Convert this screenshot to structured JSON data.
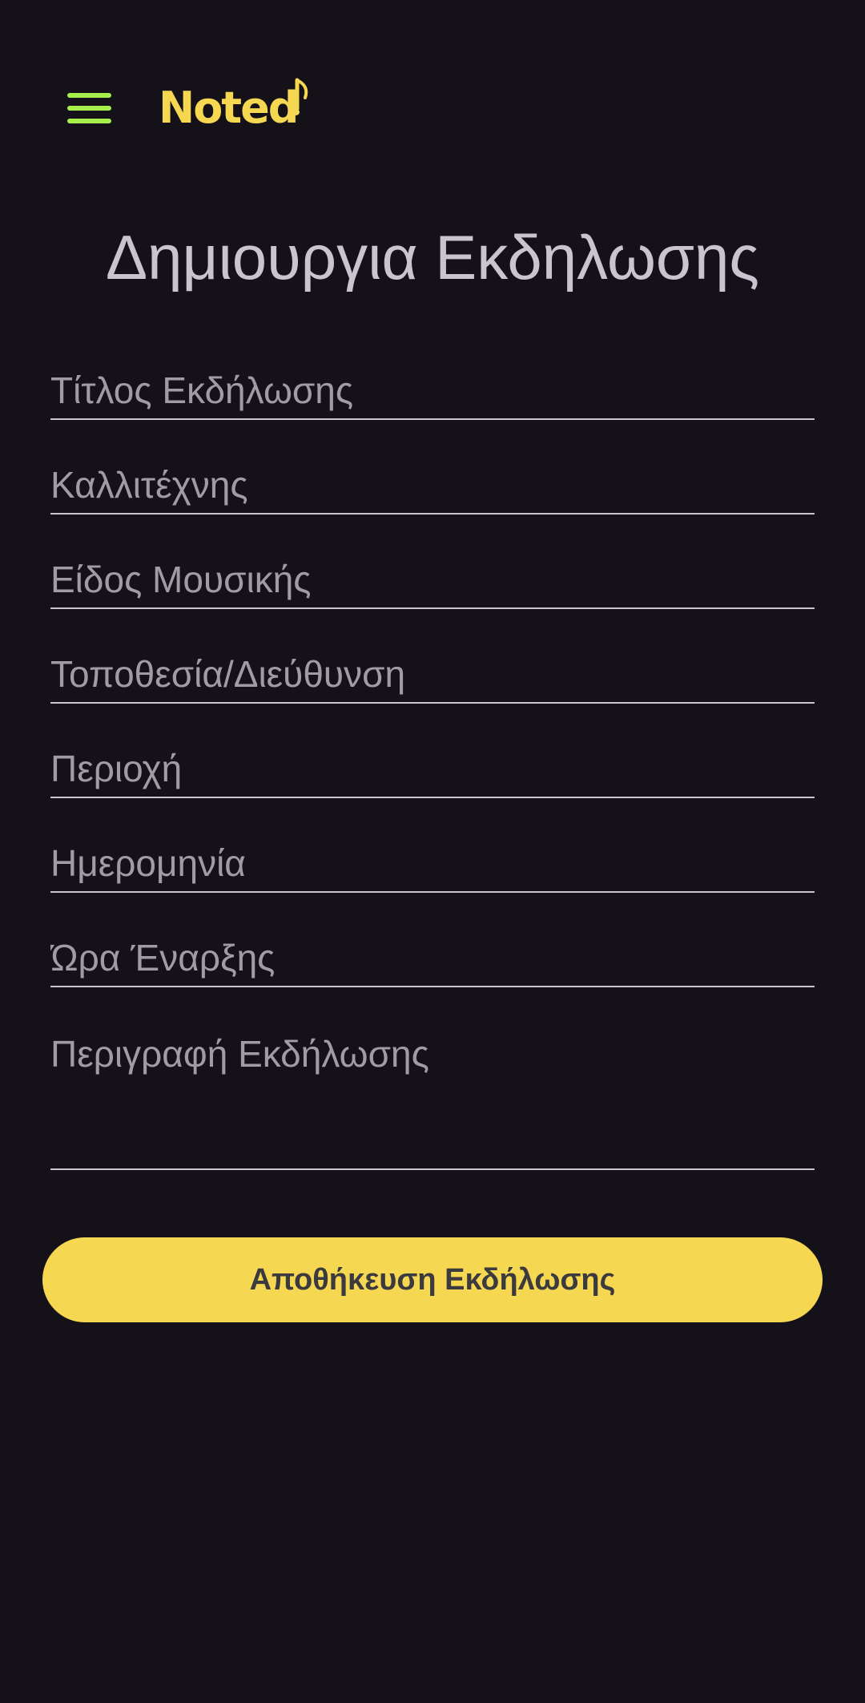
{
  "app": {
    "logo_text": "Noted",
    "menu_icon": "hamburger-menu-icon",
    "logo_icon": "music-note-icon"
  },
  "page": {
    "title": "Δημιουργια Εκδηλωσης"
  },
  "form": {
    "fields": [
      {
        "placeholder": "Τίτλος Εκδήλωσης",
        "value": ""
      },
      {
        "placeholder": "Καλλιτέχνης",
        "value": ""
      },
      {
        "placeholder": "Είδος Μουσικής",
        "value": ""
      },
      {
        "placeholder": "Τοποθεσία/Διεύθυνση",
        "value": ""
      },
      {
        "placeholder": "Περιοχή",
        "value": ""
      },
      {
        "placeholder": "Ημερομηνία",
        "value": ""
      },
      {
        "placeholder": "Ώρα Έναρξης",
        "value": ""
      },
      {
        "placeholder": "Περιγραφή Εκδήλωσης",
        "value": ""
      }
    ],
    "save_label": "Αποθήκευση Εκδήλωσης"
  },
  "colors": {
    "background": "#141218",
    "accent_yellow": "#f5d751",
    "menu_green": "#a6ef4c",
    "text_light": "#cac4d0",
    "placeholder": "#a19ba8"
  }
}
